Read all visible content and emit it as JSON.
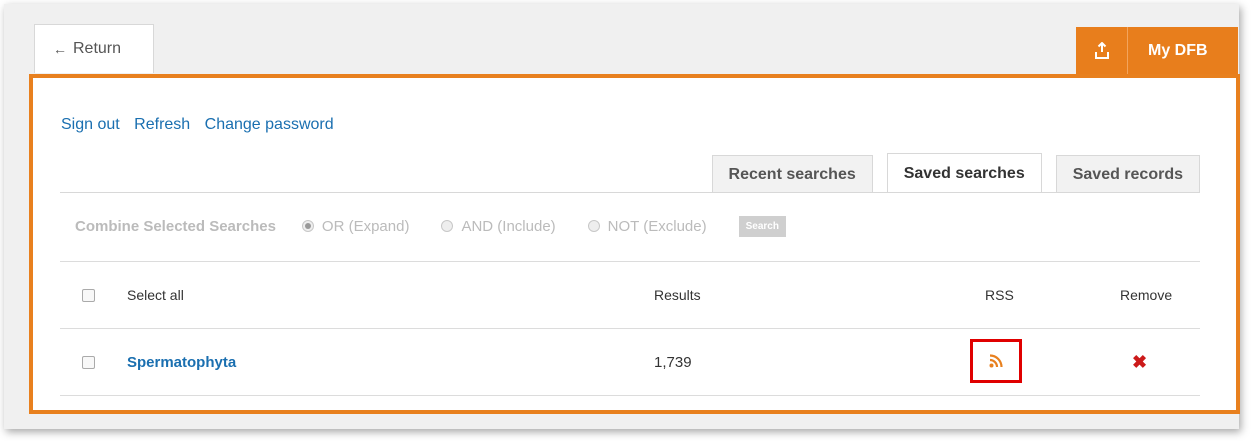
{
  "nav": {
    "return_label": "Return",
    "return_arrow": "←",
    "mydfb_label": "My DFB"
  },
  "links": {
    "sign_out": "Sign out",
    "refresh": "Refresh",
    "change_password": "Change password"
  },
  "tabs": [
    {
      "label": "Recent searches",
      "active": false
    },
    {
      "label": "Saved searches",
      "active": true
    },
    {
      "label": "Saved records",
      "active": false
    }
  ],
  "combine": {
    "title": "Combine Selected Searches",
    "options": [
      {
        "label": "OR (Expand)",
        "checked": true
      },
      {
        "label": "AND (Include)",
        "checked": false
      },
      {
        "label": "NOT (Exclude)",
        "checked": false
      }
    ],
    "search_button": "Search"
  },
  "table": {
    "headers": {
      "select_all": "Select all",
      "results": "Results",
      "rss": "RSS",
      "remove": "Remove"
    },
    "rows": [
      {
        "name": "Spermatophyta",
        "results": "1,739",
        "remove_symbol": "✖"
      }
    ]
  },
  "colors": {
    "accent": "#e8801e",
    "link": "#1a6fb0",
    "highlight": "#e00000",
    "remove": "#cc1a1a"
  },
  "icons": [
    "left-arrow-icon",
    "export-icon",
    "rss-icon",
    "remove-icon"
  ]
}
